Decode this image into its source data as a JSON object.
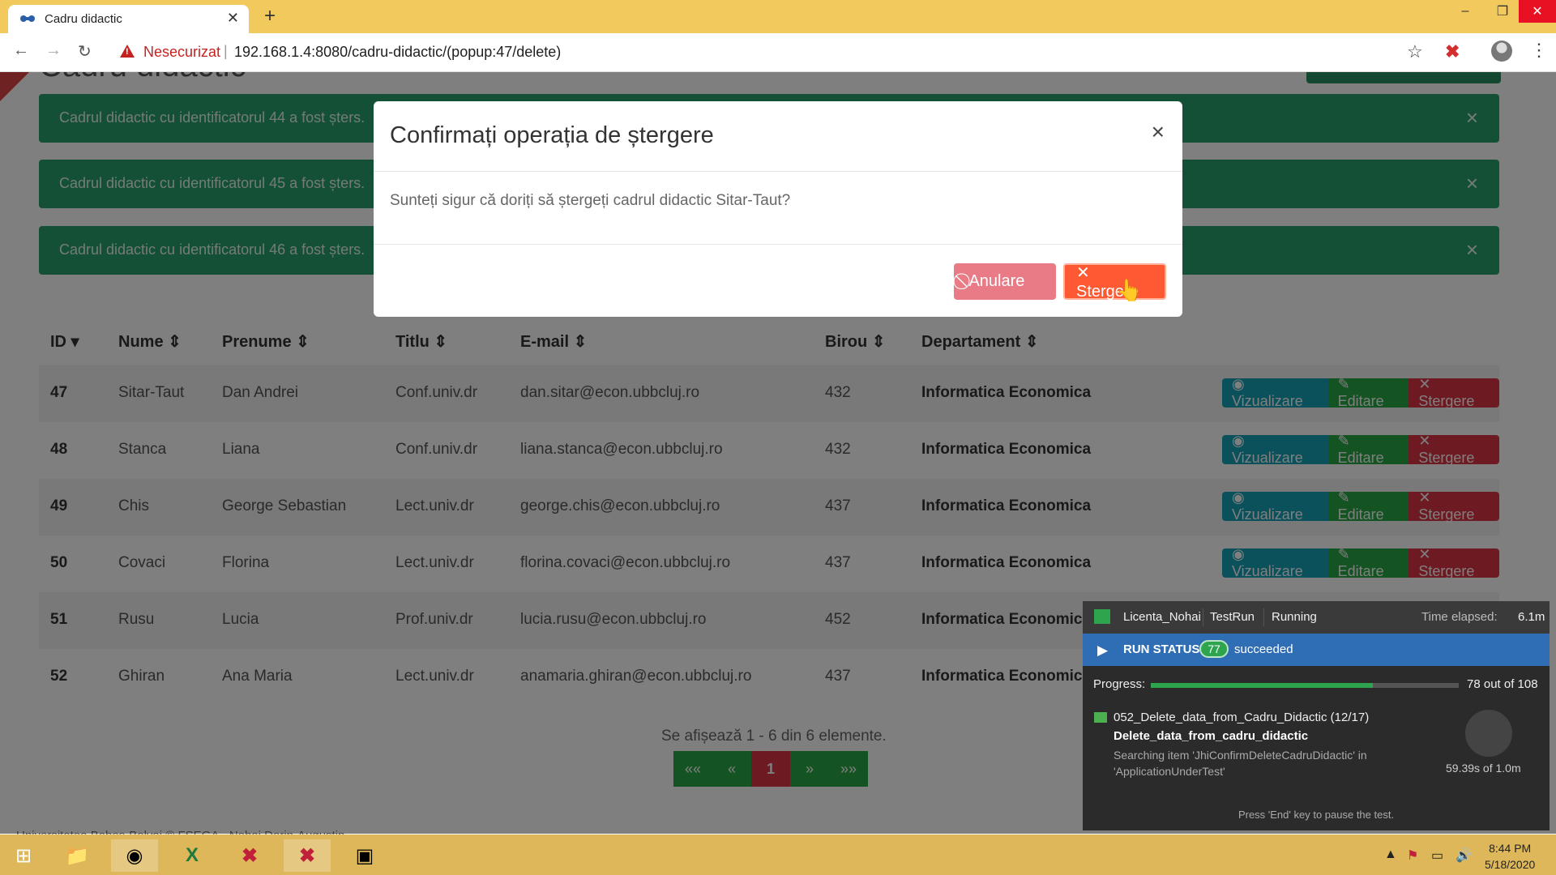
{
  "browser": {
    "tab_title": "Cadru didactic",
    "tab_close": "✕",
    "new_tab": "+",
    "insecure_label": "Nesecurizat",
    "separator": "|",
    "url": "192.168.1.4:8080/cadru-didactic/(popup:47/delete)",
    "window_controls": [
      "–",
      "❐",
      "✕"
    ]
  },
  "page": {
    "heading": "Cadru didactic",
    "alerts": [
      {
        "text": "Cadrul didactic cu identificatorul 44 a fost șters.",
        "close": "×"
      },
      {
        "text": "Cadrul didactic cu identificatorul 45 a fost șters.",
        "close": "×"
      },
      {
        "text": "Cadrul didactic cu identificatorul 46 a fost șters.",
        "close": "×"
      }
    ],
    "table": {
      "headers": [
        "ID ▾",
        "Nume ⇕",
        "Prenume ⇕",
        "Titlu ⇕",
        "E-mail ⇕",
        "Birou ⇕",
        "Departament ⇕"
      ],
      "rows": [
        {
          "id": "47",
          "nume": "Sitar-Taut",
          "prenume": "Dan Andrei",
          "titlu": "Conf.univ.dr",
          "email": "dan.sitar@econ.ubbcluj.ro",
          "birou": "432",
          "dept": "Informatica Economica"
        },
        {
          "id": "48",
          "nume": "Stanca",
          "prenume": "Liana",
          "titlu": "Conf.univ.dr",
          "email": "liana.stanca@econ.ubbcluj.ro",
          "birou": "432",
          "dept": "Informatica Economica"
        },
        {
          "id": "49",
          "nume": "Chis",
          "prenume": "George Sebastian",
          "titlu": "Lect.univ.dr",
          "email": "george.chis@econ.ubbcluj.ro",
          "birou": "437",
          "dept": "Informatica Economica"
        },
        {
          "id": "50",
          "nume": "Covaci",
          "prenume": "Florina",
          "titlu": "Lect.univ.dr",
          "email": "florina.covaci@econ.ubbcluj.ro",
          "birou": "437",
          "dept": "Informatica Economica"
        },
        {
          "id": "51",
          "nume": "Rusu",
          "prenume": "Lucia",
          "titlu": "Prof.univ.dr",
          "email": "lucia.rusu@econ.ubbcluj.ro",
          "birou": "452",
          "dept": "Informatica Economica"
        },
        {
          "id": "52",
          "nume": "Ghiran",
          "prenume": "Ana Maria",
          "titlu": "Lect.univ.dr",
          "email": "anamaria.ghiran@econ.ubbcluj.ro",
          "birou": "437",
          "dept": "Informatica Economica"
        }
      ],
      "actions": {
        "view": "◉ Vizualizare",
        "edit": "✎ Editare",
        "delete": "✕ Stergere"
      }
    },
    "summary": "Se afișează 1 - 6 din 6 elemente.",
    "pagination": [
      "««",
      "«",
      "1",
      "»",
      "»»"
    ],
    "footer": "Universitatea Babeș-Bolyai © FSEGA - Nohai Dorin-Augustin"
  },
  "modal": {
    "title": "Confirmați operația de ștergere",
    "close": "×",
    "body": "Sunteți sigur că doriți să ștergeți cadrul didactic Sitar-Taut?",
    "cancel_label": "⃠ Anulare",
    "delete_label": "✕ Stergere"
  },
  "ranorex": {
    "project": "Licenta_Nohai",
    "run": "TestRun",
    "state": "Running",
    "time_label": "Time elapsed:",
    "time_value": "6.1m",
    "status_label": "RUN STATUS",
    "succeeded_count": "77",
    "succeeded_label": "succeeded",
    "progress_label": "Progress:",
    "progress_fraction": 0.722,
    "progress_count": "78 out of 108",
    "item": "052_Delete_data_from_Cadru_Didactic (12/17)",
    "sub_item": "Delete_data_from_cadru_didactic",
    "description": "Searching item 'JhiConfirmDeleteCadruDidactic' in 'ApplicationUnderTest'",
    "item_time": "59.39s of 1.0m",
    "hint": "Press 'End' key to pause the test."
  },
  "taskbar": {
    "time": "8:44 PM",
    "date": "5/18/2020"
  },
  "colors": {
    "accent_green": "#28a06d",
    "danger": "#dc3545",
    "info": "#17a2b8",
    "taskbar": "#ddb75a"
  }
}
